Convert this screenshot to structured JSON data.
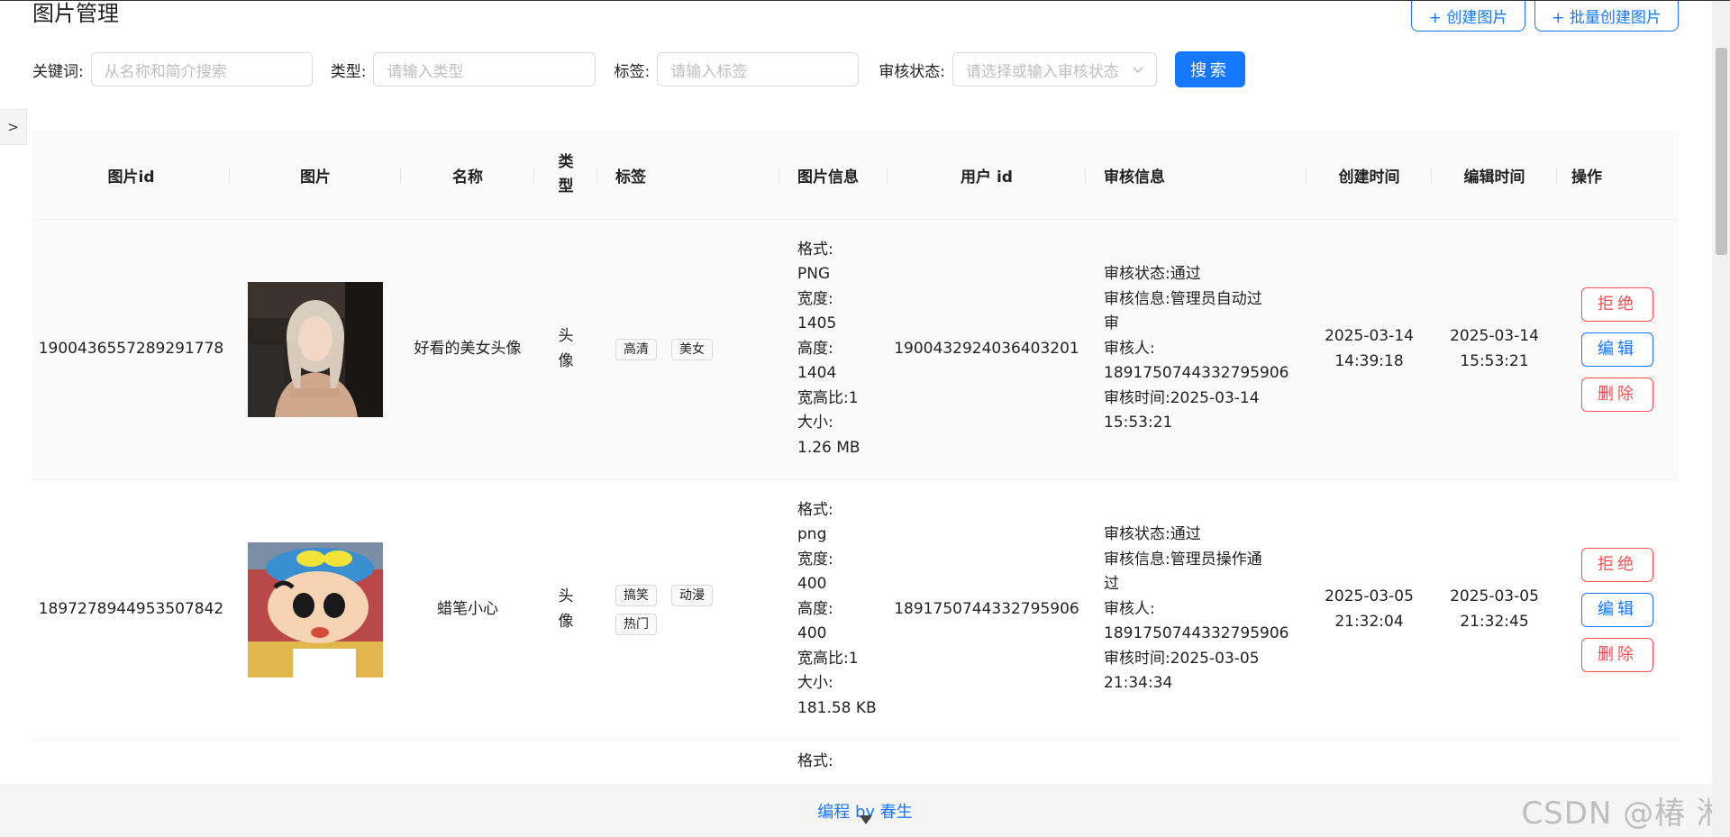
{
  "page": {
    "title": "图片管理"
  },
  "toolbar": {
    "create_label": "+ 创建图片",
    "batch_label": "+ 批量创建图片"
  },
  "filters": {
    "keyword_label": "关键词:",
    "keyword_placeholder": "从名称和简介搜索",
    "type_label": "类型:",
    "type_placeholder": "请输入类型",
    "tag_label": "标签:",
    "tag_placeholder": "请输入标签",
    "review_label": "审核状态:",
    "review_placeholder": "请选择或输入审核状态",
    "search_label": "搜索"
  },
  "sidebar": {
    "toggle_label": ">"
  },
  "table": {
    "headers": {
      "id": "图片id",
      "image": "图片",
      "name": "名称",
      "type": "类型",
      "tags": "标签",
      "info": "图片信息",
      "user": "用户 id",
      "review": "审核信息",
      "created": "创建时间",
      "edited": "编辑时间",
      "actions": "操作"
    },
    "actions": {
      "reject": "拒绝",
      "edit": "编辑",
      "delete": "删除"
    },
    "rows": [
      {
        "id": "1900436557289291778",
        "name": "好看的美女头像",
        "type": "头像",
        "tags": [
          "高清",
          "美女"
        ],
        "info": [
          "格式:",
          "PNG",
          "宽度:",
          "1405",
          "高度:",
          "1404",
          "宽高比:1",
          "大小:",
          "1.26 MB"
        ],
        "user_id": "1900432924036403201",
        "review": [
          "审核状态:通过",
          "审核信息:管理员自动过",
          "审",
          "审核人:",
          "1891750744332795906",
          "审核时间:2025-03-14",
          "15:53:21"
        ],
        "created": [
          "2025-03-14",
          "14:39:18"
        ],
        "edited": [
          "2025-03-14",
          "15:53:21"
        ]
      },
      {
        "id": "1897278944953507842",
        "name": "蜡笔小心",
        "type": "头像",
        "tags": [
          "搞笑",
          "动漫",
          "热门"
        ],
        "info": [
          "格式:",
          "png",
          "宽度:",
          "400",
          "高度:",
          "400",
          "宽高比:1",
          "大小:",
          "181.58 KB"
        ],
        "user_id": "1891750744332795906",
        "review": [
          "审核状态:通过",
          "审核信息:管理员操作通",
          "过",
          "审核人:",
          "1891750744332795906",
          "审核时间:2025-03-05",
          "21:34:34"
        ],
        "created": [
          "2025-03-05",
          "21:32:04"
        ],
        "edited": [
          "2025-03-05",
          "21:32:45"
        ]
      },
      {
        "info_partial": "格式:"
      }
    ]
  },
  "footer": {
    "link": "编程 by 春生"
  },
  "watermark": "CSDN @椿 淞",
  "colors": {
    "primary": "#1677ff",
    "danger": "#ff4d4f"
  }
}
